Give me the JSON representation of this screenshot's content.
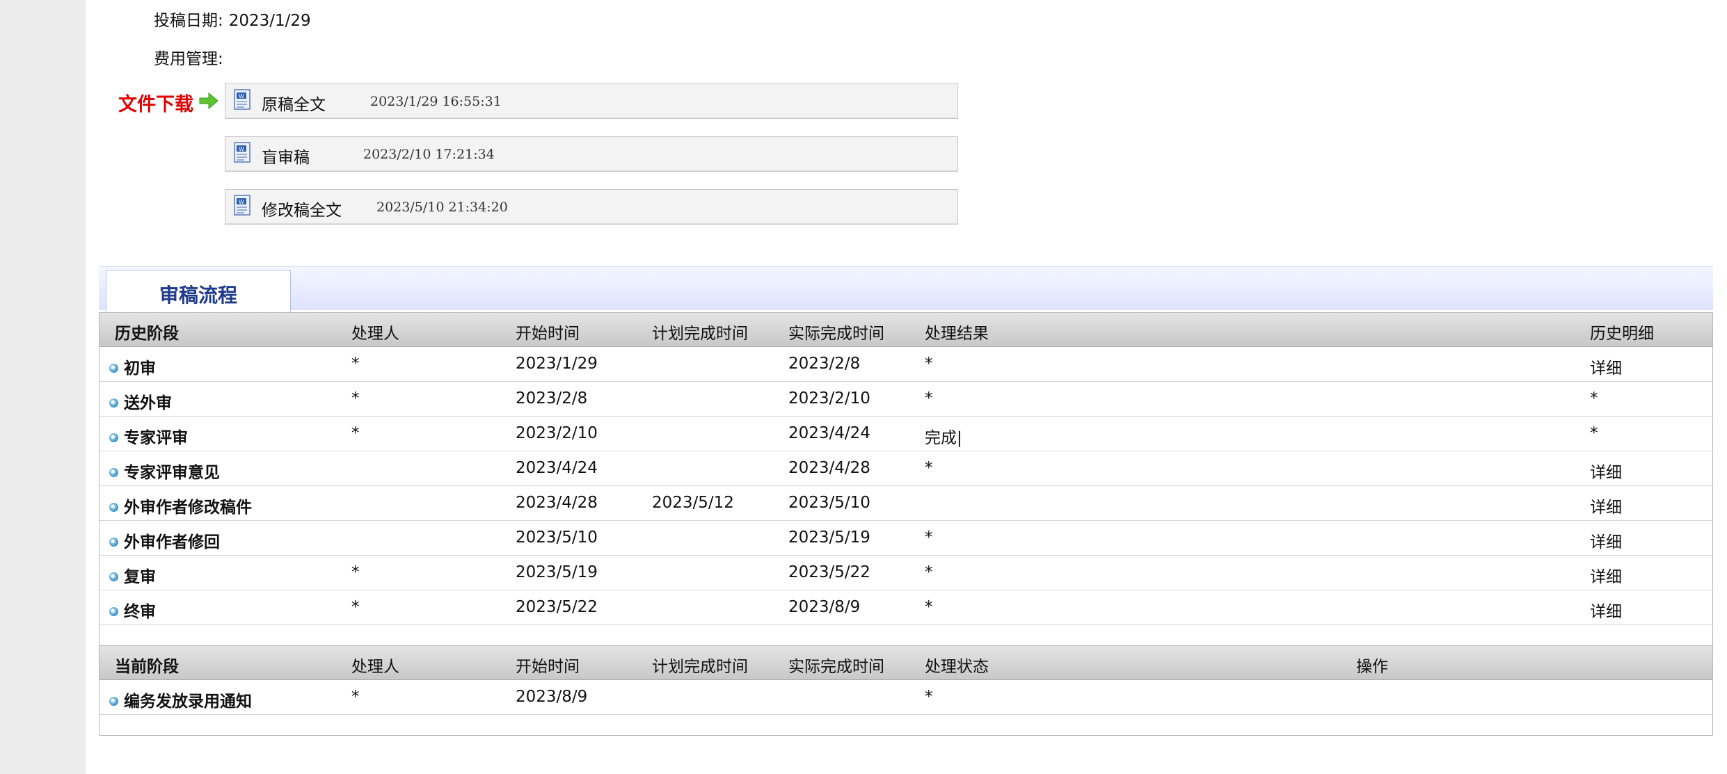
{
  "submission": {
    "date_label": "投稿日期:",
    "date_value": "2023/1/29",
    "fee_label": "费用管理:"
  },
  "downloads": {
    "label": "文件下载",
    "files": [
      {
        "name": "原稿全文",
        "date": "2023/1/29 16:55:31"
      },
      {
        "name": "盲审稿",
        "date": "2023/2/10 17:21:34"
      },
      {
        "name": "修改稿全文",
        "date": "2023/5/10 21:34:20"
      }
    ]
  },
  "review": {
    "tab_label": "审稿流程",
    "history_headers": [
      "历史阶段",
      "处理人",
      "开始时间",
      "计划完成时间",
      "实际完成时间",
      "处理结果",
      "历史明细"
    ],
    "history_rows": [
      {
        "stage": "初审",
        "handler": "*",
        "start": "2023/1/29",
        "planned": "",
        "actual": "2023/2/8",
        "result": "*",
        "detail": "详细"
      },
      {
        "stage": "送外审",
        "handler": "*",
        "start": "2023/2/8",
        "planned": "",
        "actual": "2023/2/10",
        "result": "*",
        "detail": "*"
      },
      {
        "stage": "专家评审",
        "handler": "*",
        "start": "2023/2/10",
        "planned": "",
        "actual": "2023/4/24",
        "result": "完成|",
        "detail": "*"
      },
      {
        "stage": "专家评审意见",
        "handler": "",
        "start": "2023/4/24",
        "planned": "",
        "actual": "2023/4/28",
        "result": "*",
        "detail": "详细"
      },
      {
        "stage": "外审作者修改稿件",
        "handler": "",
        "start": "2023/4/28",
        "planned": "2023/5/12",
        "actual": "2023/5/10",
        "result": "",
        "detail": "详细"
      },
      {
        "stage": "外审作者修回",
        "handler": "",
        "start": "2023/5/10",
        "planned": "",
        "actual": "2023/5/19",
        "result": "*",
        "detail": "详细"
      },
      {
        "stage": "复审",
        "handler": "*",
        "start": "2023/5/19",
        "planned": "",
        "actual": "2023/5/22",
        "result": "*",
        "detail": "详细"
      },
      {
        "stage": "终审",
        "handler": "*",
        "start": "2023/5/22",
        "planned": "",
        "actual": "2023/8/9",
        "result": "*",
        "detail": "详细"
      }
    ],
    "current_headers": [
      "当前阶段",
      "处理人",
      "开始时间",
      "计划完成时间",
      "实际完成时间",
      "处理状态",
      "操作"
    ],
    "current_rows": [
      {
        "stage": "编务发放录用通知",
        "handler": "*",
        "start": "2023/8/9",
        "planned": "",
        "actual": "",
        "status": "*",
        "action": ""
      }
    ]
  },
  "colors": {
    "download_label": "#e00000",
    "link": "#1a2fa8",
    "tab_text": "#1f3a8a"
  }
}
